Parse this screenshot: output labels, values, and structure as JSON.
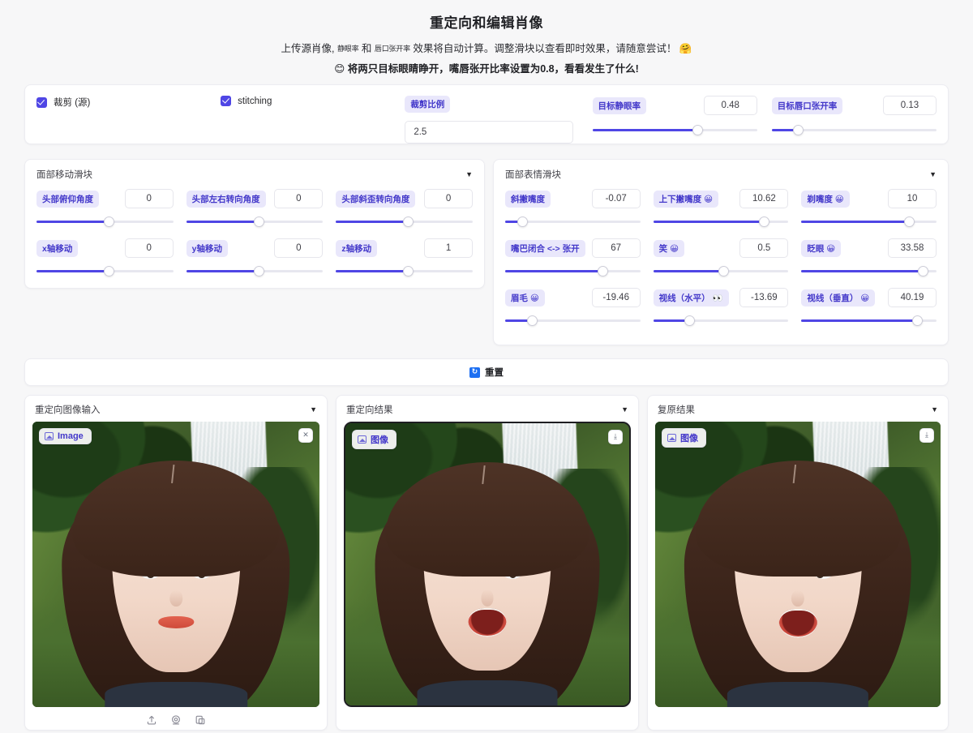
{
  "header": {
    "title": "重定向和编辑肖像",
    "subtitle_part1": "上传源肖像,",
    "subtitle_small1": "静眼率",
    "subtitle_mid": "和",
    "subtitle_small2": "唇口张开率",
    "subtitle_part2": "效果将自动计算。调整滑块以查看即时效果，请随意尝试！",
    "subtitle_emoji": "🤗",
    "tip_emoji": "😊",
    "tip_text": "将两只目标眼睛睁开，嘴唇张开比率设置为0.8，看看发生了什么!"
  },
  "top_row": {
    "crop_checkbox_label": "裁剪 (源)",
    "crop_checked": true,
    "stitching_checkbox_label": "stitching",
    "stitching_checked": true,
    "crop_ratio_label": "裁剪比例",
    "crop_ratio_value": "2.5",
    "sliders": [
      {
        "label": "目标静眼率",
        "value": "0.48",
        "fill_pct": 64
      },
      {
        "label": "目标唇口张开率",
        "value": "0.13",
        "fill_pct": 16
      }
    ]
  },
  "panel_move": {
    "title": "面部移动滑块",
    "caret": "▼",
    "rows": [
      [
        {
          "label": "头部俯仰角度",
          "value": "0",
          "fill_pct": 53
        },
        {
          "label": "头部左右转向角度",
          "value": "0",
          "fill_pct": 53
        },
        {
          "label": "头部斜歪转向角度",
          "value": "0",
          "fill_pct": 53
        }
      ],
      [
        {
          "label": "x轴移动",
          "value": "0",
          "fill_pct": 53
        },
        {
          "label": "y轴移动",
          "value": "0",
          "fill_pct": 53
        },
        {
          "label": "z轴移动",
          "value": "1",
          "fill_pct": 53
        }
      ]
    ]
  },
  "panel_expr": {
    "title": "面部表情滑块",
    "caret": "▼",
    "rows": [
      [
        {
          "label": "斜撇嘴度",
          "emoji": "",
          "value": "-0.07",
          "fill_pct": 13
        },
        {
          "label": "上下撇嘴度",
          "emoji": "😀",
          "value": "10.62",
          "fill_pct": 82
        },
        {
          "label": "剃嘴度",
          "emoji": "😀",
          "value": "10",
          "fill_pct": 80
        }
      ],
      [
        {
          "label": "嘴巴闭合 <-> 张开",
          "emoji": "",
          "value": "67",
          "fill_pct": 72
        },
        {
          "label": "笑",
          "emoji": "😀",
          "value": "0.5",
          "fill_pct": 52
        },
        {
          "label": "眨眼",
          "emoji": "😀",
          "value": "33.58",
          "fill_pct": 90
        }
      ],
      [
        {
          "label": "眉毛",
          "emoji": "😀",
          "value": "-19.46",
          "fill_pct": 20
        },
        {
          "label": "视线（水平）",
          "emoji": "👀",
          "value": "-13.69",
          "fill_pct": 27
        },
        {
          "label": "视线（垂直）",
          "emoji": "😀",
          "value": "40.19",
          "fill_pct": 86
        }
      ]
    ]
  },
  "reset": {
    "label": "重置",
    "icon": "refresh-icon",
    "icon_glyph": "↻"
  },
  "image_panels": [
    {
      "title": "重定向图像输入",
      "caret": "▼",
      "badge": "Image",
      "corner_action": "clear",
      "corner_glyph": "✕",
      "framed": false,
      "tools": [
        "upload-icon",
        "webcam-icon",
        "clipboard-icon"
      ]
    },
    {
      "title": "重定向结果",
      "caret": "▼",
      "badge": "图像",
      "corner_action": "download",
      "corner_glyph": "⤓",
      "framed": true,
      "tools": []
    },
    {
      "title": "复原结果",
      "caret": "▼",
      "badge": "图像",
      "corner_action": "download",
      "corner_glyph": "⤓",
      "framed": false,
      "tools": []
    }
  ],
  "colors": {
    "accent": "#4f46e5",
    "label_bg": "#e9e7fb",
    "label_fg": "#4338ca",
    "page_bg": "#f7f7f8",
    "card_bg": "#ffffff",
    "reset_icon_bg": "#1d6ff2"
  }
}
